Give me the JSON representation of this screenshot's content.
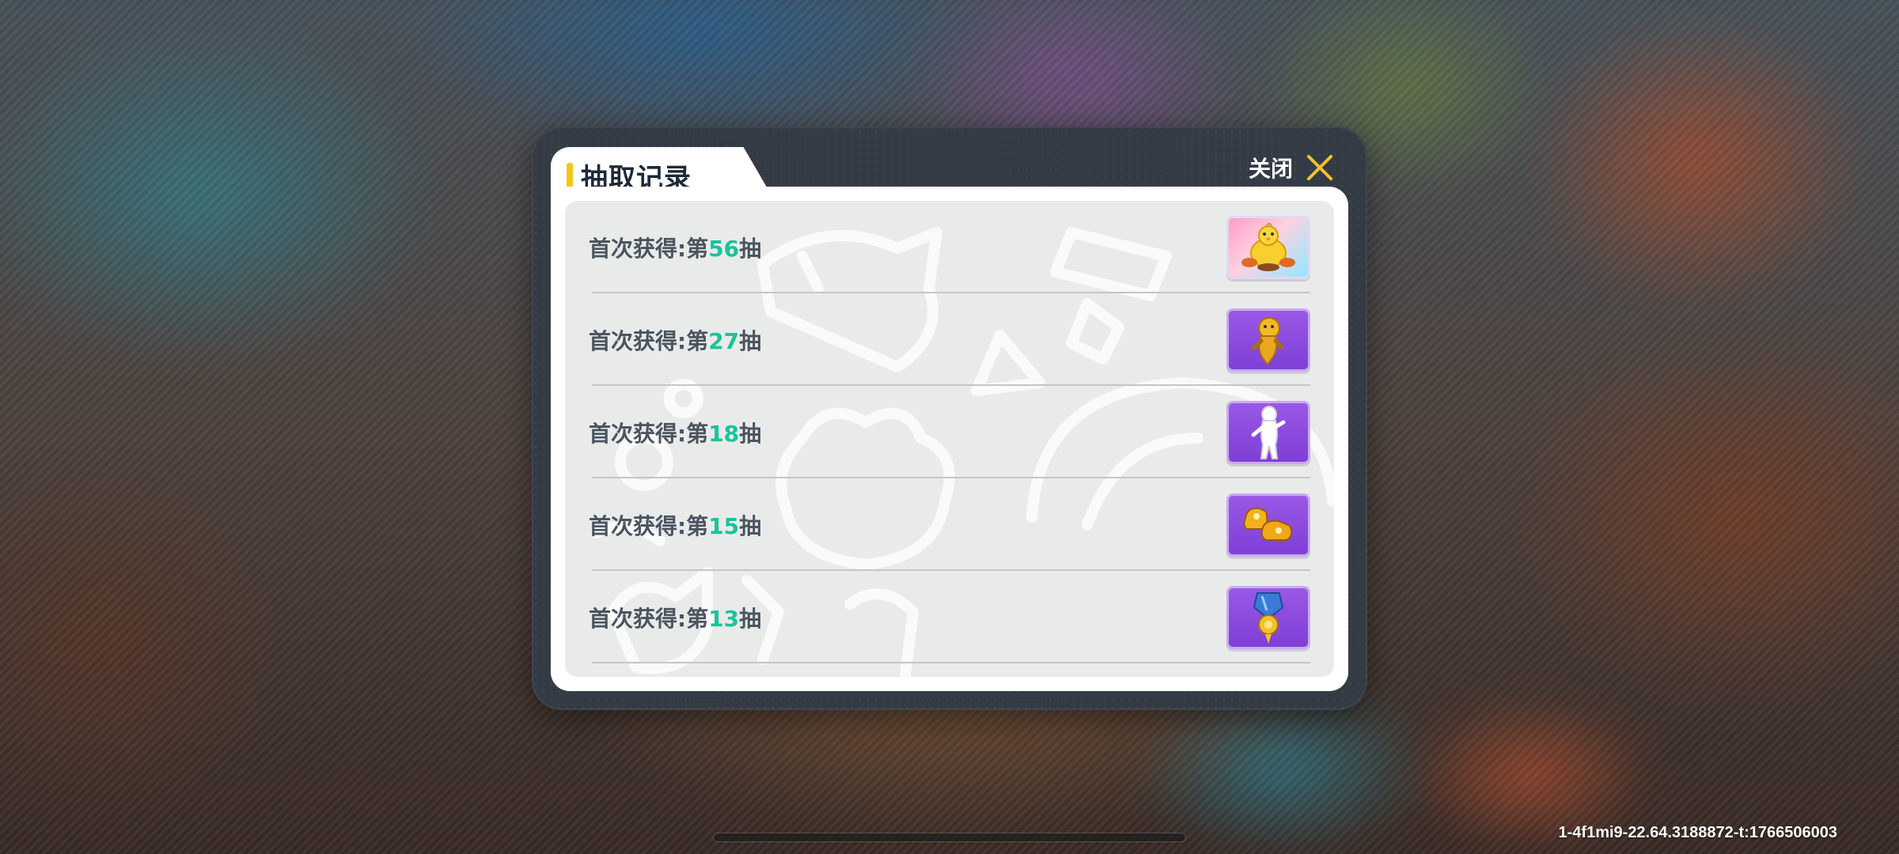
{
  "dialog": {
    "title": "抽取记录",
    "close_label": "关闭"
  },
  "records": [
    {
      "prefix": "首次获得:第",
      "count": "56",
      "suffix": "抽",
      "item_icon": "chick-plush-icon",
      "rarity": "rare"
    },
    {
      "prefix": "首次获得:第",
      "count": "27",
      "suffix": "抽",
      "item_icon": "golden-character-icon",
      "rarity": "epic"
    },
    {
      "prefix": "首次获得:第",
      "count": "18",
      "suffix": "抽",
      "item_icon": "white-character-icon",
      "rarity": "epic"
    },
    {
      "prefix": "首次获得:第",
      "count": "15",
      "suffix": "抽",
      "item_icon": "golden-shoes-icon",
      "rarity": "epic"
    },
    {
      "prefix": "首次获得:第",
      "count": "13",
      "suffix": "抽",
      "item_icon": "blue-medal-icon",
      "rarity": "epic"
    }
  ],
  "watermark": "1-4f1mi9-22.64.3188872-t:1766506003",
  "colors": {
    "accent_yellow": "#f5c518",
    "count_green": "#19c49a",
    "epic_purple": "#8b4bdd",
    "dialog_dark": "#343b44"
  }
}
